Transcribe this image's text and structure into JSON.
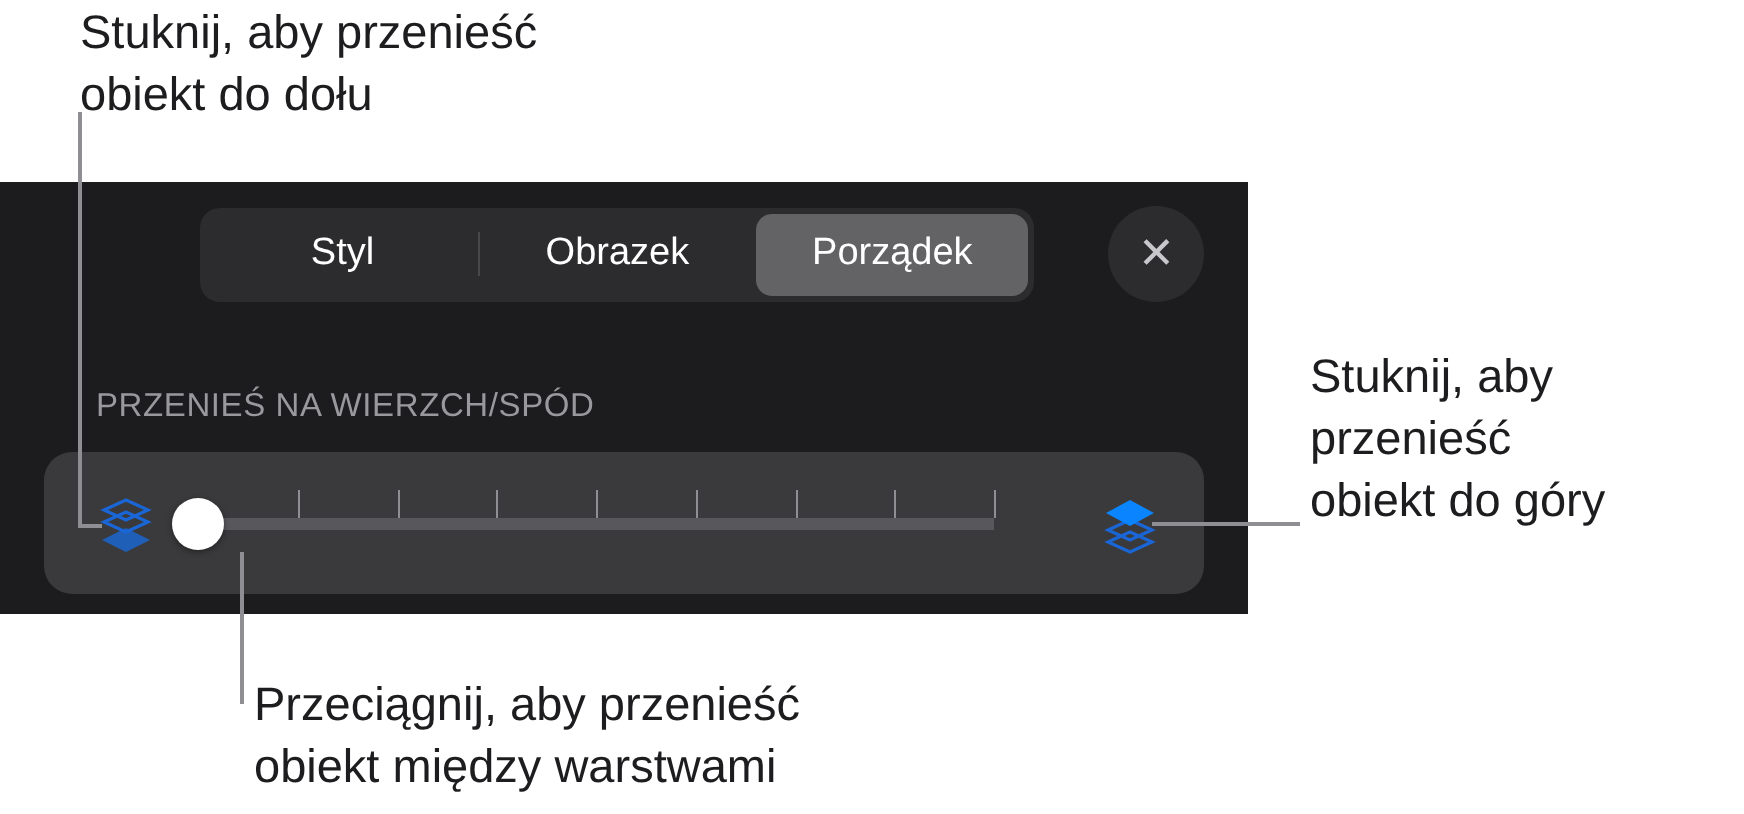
{
  "tabs": [
    {
      "label": "Styl",
      "selected": false
    },
    {
      "label": "Obrazek",
      "selected": false
    },
    {
      "label": "Porządek",
      "selected": true
    }
  ],
  "close_button": {
    "label": "✕"
  },
  "section_label": "PRZENIEŚ NA WIERZCH/SPÓD",
  "slider": {
    "level": 0
  },
  "callouts": [
    {
      "kind": "left",
      "text": "Stuknij, aby przenieść\nobiekt do dołu"
    },
    {
      "kind": "right",
      "text": "Stuknij, aby\nprzenieść\nobiekt do góry"
    },
    {
      "kind": "bottom",
      "text": "Przeciągnij, aby przenieść\nobiekt między warstwami"
    }
  ]
}
